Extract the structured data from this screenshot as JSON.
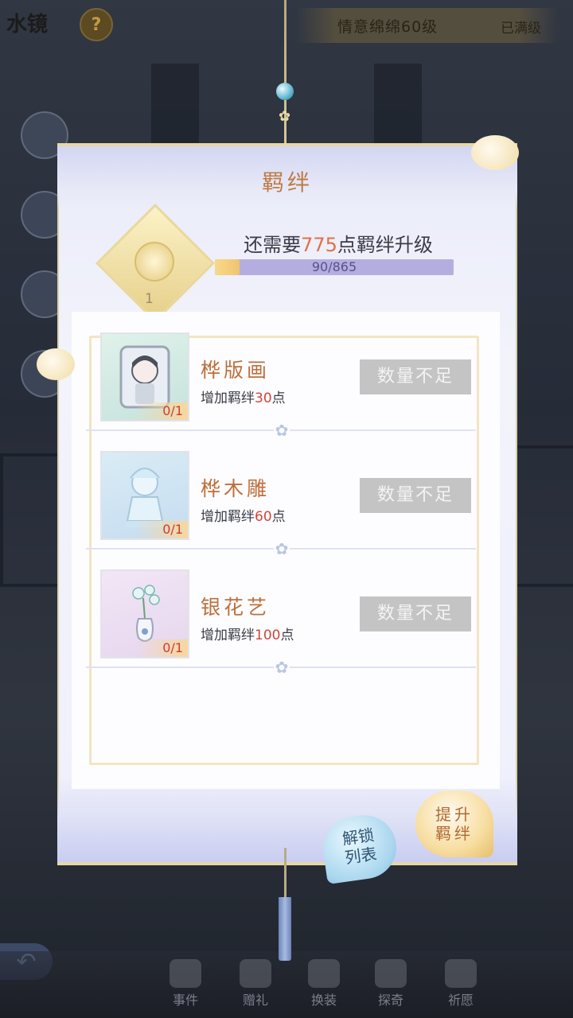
{
  "header": {
    "title": "水镜",
    "help_label": "?",
    "level_text": "情意绵绵60级",
    "max_text": "已满级"
  },
  "panel": {
    "title": "羁绊",
    "need_prefix": "还需要",
    "need_points": "775",
    "need_suffix": "点羁绊升级",
    "progress_text": "90/865",
    "progress_fraction": 0.104,
    "emblem_level": "1"
  },
  "items": [
    {
      "name": "桦版画",
      "desc_prefix": "增加羁绊",
      "points": "30",
      "desc_suffix": "点",
      "count": "0/1",
      "button": "数量不足"
    },
    {
      "name": "桦木雕",
      "desc_prefix": "增加羁绊",
      "points": "60",
      "desc_suffix": "点",
      "count": "0/1",
      "button": "数量不足"
    },
    {
      "name": "银花艺",
      "desc_prefix": "增加羁绊",
      "points": "100",
      "desc_suffix": "点",
      "count": "0/1",
      "button": "数量不足"
    }
  ],
  "actions": {
    "unlock_line1": "解锁",
    "unlock_line2": "列表",
    "upgrade_line1": "提升",
    "upgrade_line2": "羁绊"
  },
  "bottom_nav": [
    {
      "label": "事件",
      "icon": "letter-icon"
    },
    {
      "label": "赠礼",
      "icon": "gift-bag-icon"
    },
    {
      "label": "换装",
      "icon": "clothes-icon"
    },
    {
      "label": "探奇",
      "icon": "map-icon"
    },
    {
      "label": "祈愿",
      "icon": "bird-icon"
    }
  ],
  "colors": {
    "accent_orange": "#e07048",
    "points_red": "#d0463a",
    "title_brown": "#c07a44",
    "progress_track": "#b4aee0",
    "progress_fill": "#f2c46e",
    "disabled_button": "#c4c4c4"
  }
}
